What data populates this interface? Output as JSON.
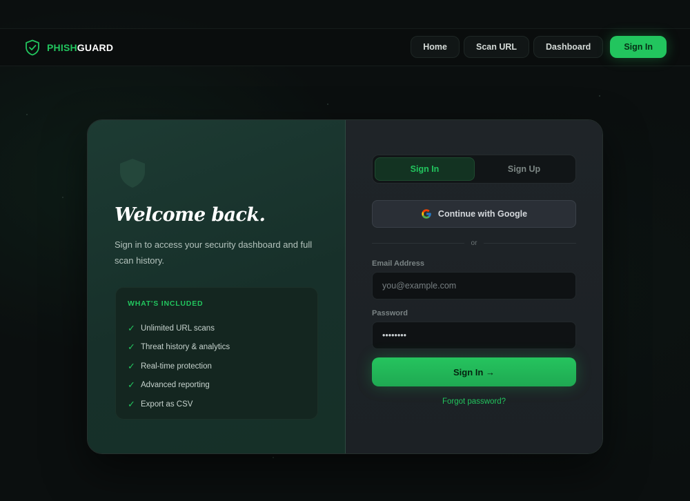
{
  "brand": {
    "name_part1": "PHISH",
    "name_part2": "GUARD"
  },
  "nav": {
    "links": [
      "Home",
      "Scan URL",
      "Dashboard"
    ],
    "cta_label": "Sign In"
  },
  "hero": {
    "title": "Welcome back.",
    "subtitle": "Sign in to access your security dashboard and full scan history."
  },
  "included": {
    "title": "WHAT'S INCLUDED",
    "check_glyph": "✓",
    "items": [
      "Unlimited URL scans",
      "Threat history & analytics",
      "Real-time protection",
      "Advanced reporting",
      "Export as CSV"
    ]
  },
  "auth": {
    "tabs": [
      "Sign In",
      "Sign Up"
    ],
    "active_tab": 0,
    "google_label": "Continue with Google",
    "divider_text": "or",
    "email_label": "Email Address",
    "email_placeholder": "you@example.com",
    "email_value": "",
    "password_label": "Password",
    "password_value": "pass1234",
    "submit_label": "Sign In →",
    "forgot_label": "Forgot password?"
  },
  "colors": {
    "accent": "#22c55e",
    "background": "#0b0f0f",
    "left_panel": "#1d3b33",
    "right_panel": "#1f2428"
  }
}
